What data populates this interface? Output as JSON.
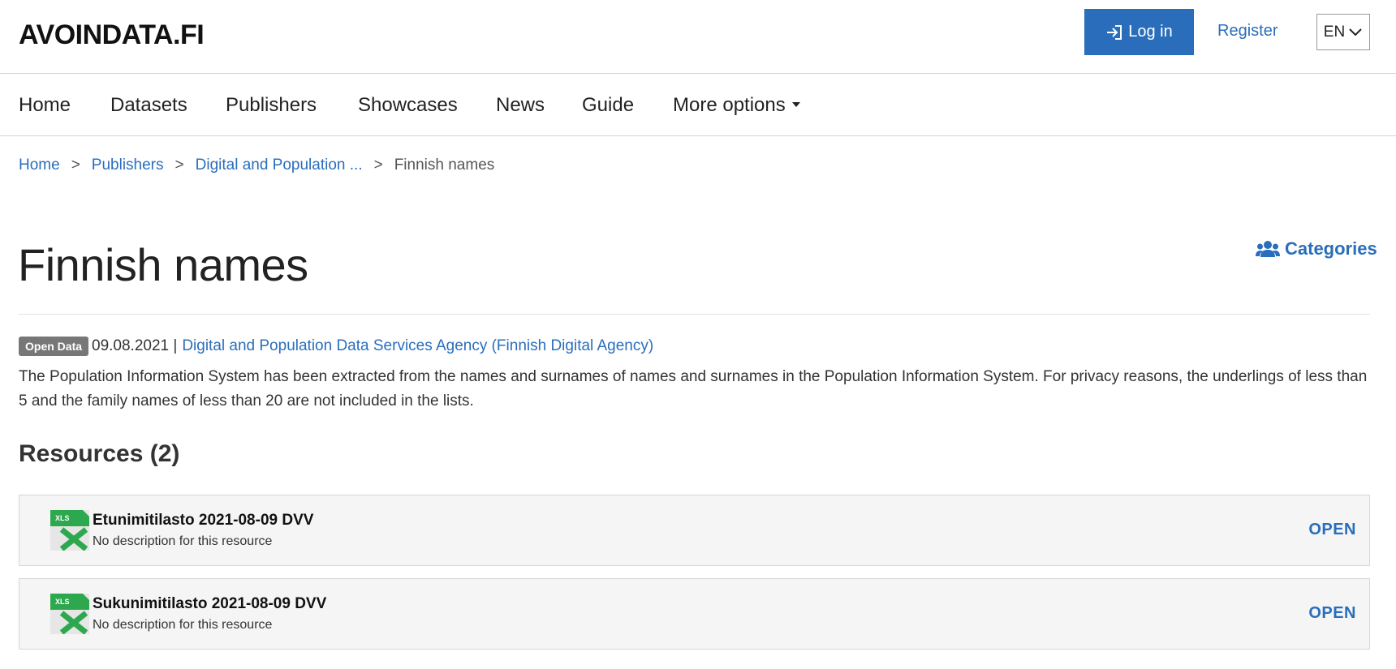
{
  "header": {
    "logo": "AVOINDATA.FI",
    "login_label": "Log in",
    "register_label": "Register",
    "language": "EN",
    "accent_color": "#2a6ebb"
  },
  "nav": {
    "items": [
      {
        "label": "Home"
      },
      {
        "label": "Datasets"
      },
      {
        "label": "Publishers"
      },
      {
        "label": "Showcases"
      },
      {
        "label": "News"
      },
      {
        "label": "Guide"
      },
      {
        "label": "More options"
      }
    ]
  },
  "breadcrumb": {
    "items": [
      "Home",
      "Publishers",
      "Digital and Population ...",
      "Finnish names"
    ],
    "separator": ">"
  },
  "page": {
    "title": "Finnish names",
    "categories_label": "Categories",
    "badge": "Open Data",
    "date": "09.08.2021",
    "meta_separator": "|",
    "publisher": "Digital and Population Data Services Agency (Finnish Digital Agency)",
    "description": "The Population Information System has been extracted from the names and surnames of names and surnames in the Population Information System. For privacy reasons, the underlings of less than 5 and the family names of less than 20 are not included in the lists."
  },
  "resources": {
    "heading": "Resources (2)",
    "items": [
      {
        "title": "Etunimitilasto 2021-08-09 DVV",
        "description": "No description for this resource",
        "format": "XLS",
        "action": "OPEN",
        "icon": "xls-file-icon"
      },
      {
        "title": "Sukunimitilasto 2021-08-09 DVV",
        "description": "No description for this resource",
        "format": "XLS",
        "action": "OPEN",
        "icon": "xls-file-icon"
      }
    ]
  }
}
